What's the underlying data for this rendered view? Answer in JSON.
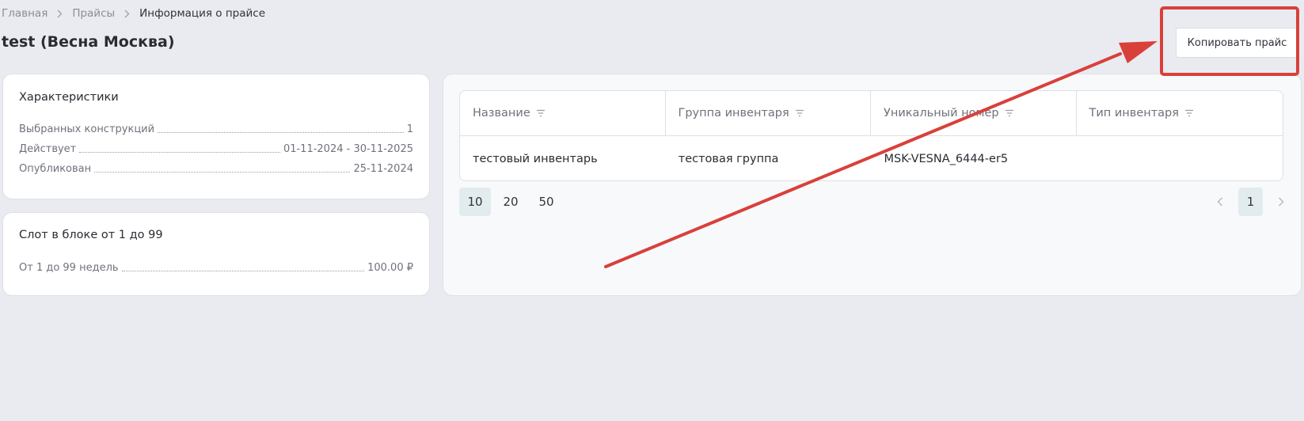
{
  "breadcrumb": {
    "items": [
      "Главная",
      "Прайсы",
      "Информация о прайсе"
    ]
  },
  "page": {
    "title": "test (Весна Москва)",
    "copy_button": "Копировать прайс"
  },
  "characteristics": {
    "title": "Характеристики",
    "rows": [
      {
        "label": "Выбранных конструкций",
        "value": "1"
      },
      {
        "label": "Действует",
        "value": "01-11-2024 - 30-11-2025"
      },
      {
        "label": "Опубликован",
        "value": "25-11-2024"
      }
    ]
  },
  "slot_block": {
    "title": "Слот в блоке от 1 до 99",
    "rows": [
      {
        "label": "От 1 до 99 недель",
        "value": "100.00 ₽"
      }
    ]
  },
  "table": {
    "columns": [
      "Название",
      "Группа инвентаря",
      "Уникальный номер",
      "Тип инвентаря"
    ],
    "rows": [
      [
        "тестовый инвентарь",
        "тестовая группа",
        "MSK-VESNA_6444-er5",
        ""
      ]
    ]
  },
  "pagination": {
    "page_sizes": [
      "10",
      "20",
      "50"
    ],
    "active_size": "10",
    "current_page": "1"
  },
  "colors": {
    "annotation": "#d9403a",
    "background": "#e9ebf1",
    "active_chip": "#e2ecef"
  },
  "icons": {
    "breadcrumb_separator": "chevron-right-icon",
    "column_filter": "filter-icon",
    "prev_page": "chevron-left-icon",
    "next_page": "chevron-right-icon"
  }
}
